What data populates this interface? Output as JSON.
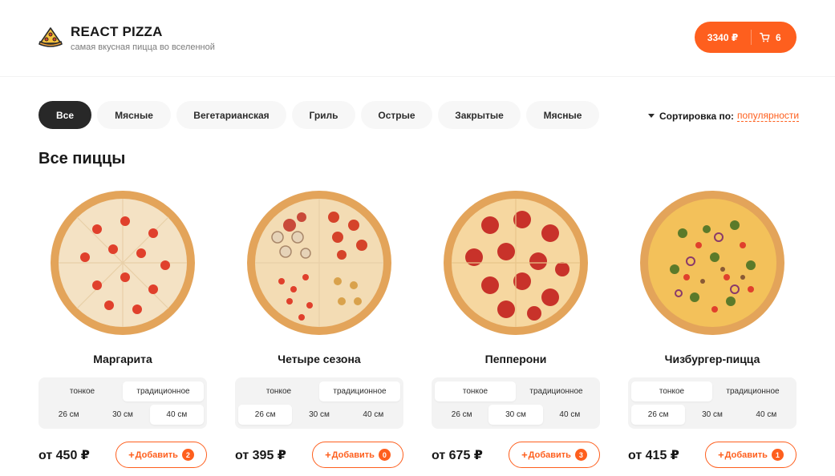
{
  "header": {
    "title": "REACT PIZZA",
    "subtitle": "самая вкусная пицца во вселенной",
    "cart_total": "3340 ₽",
    "cart_count": "6"
  },
  "categories": [
    {
      "label": "Все",
      "active": true
    },
    {
      "label": "Мясные",
      "active": false
    },
    {
      "label": "Вегетарианская",
      "active": false
    },
    {
      "label": "Гриль",
      "active": false
    },
    {
      "label": "Острые",
      "active": false
    },
    {
      "label": "Закрытые",
      "active": false
    },
    {
      "label": "Мясные",
      "active": false
    }
  ],
  "sort": {
    "label": "Сортировка по:",
    "value": "популярности"
  },
  "section_title": "Все пиццы",
  "pizzas": [
    {
      "name": "Маргарита",
      "price": "от 450 ₽",
      "add_label": "Добавить",
      "count": "2",
      "types": [
        "тонкое",
        "традиционное"
      ],
      "type_selected": 1,
      "sizes": [
        "26 см",
        "30 см",
        "40 см"
      ],
      "size_selected": 2
    },
    {
      "name": "Четыре сезона",
      "price": "от 395 ₽",
      "add_label": "Добавить",
      "count": "0",
      "types": [
        "тонкое",
        "традиционное"
      ],
      "type_selected": 1,
      "sizes": [
        "26 см",
        "30 см",
        "40 см"
      ],
      "size_selected": 0
    },
    {
      "name": "Пепперони",
      "price": "от 675 ₽",
      "add_label": "Добавить",
      "count": "3",
      "types": [
        "тонкое",
        "традиционное"
      ],
      "type_selected": 0,
      "sizes": [
        "26 см",
        "30 см",
        "40 см"
      ],
      "size_selected": 1
    },
    {
      "name": "Чизбургер-пицца",
      "price": "от 415 ₽",
      "add_label": "Добавить",
      "count": "1",
      "types": [
        "тонкое",
        "традиционное"
      ],
      "type_selected": 0,
      "sizes": [
        "26 см",
        "30 см",
        "40 см"
      ],
      "size_selected": 0
    }
  ],
  "colors": {
    "accent": "#fe5f1e",
    "dark": "#282828",
    "chip": "#f7f7f7",
    "selector_bg": "#f3f3f3"
  },
  "icons": {
    "logo": "pizza-slice-icon",
    "cart": "cart-icon",
    "sort": "caret-down-icon"
  }
}
